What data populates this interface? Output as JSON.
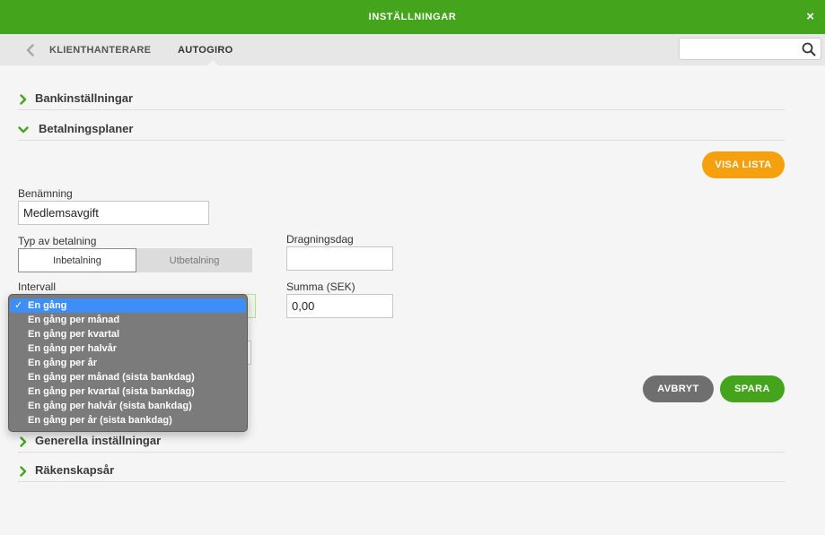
{
  "window": {
    "title": "INSTÄLLNINGAR",
    "close_glyph": "×"
  },
  "nav": {
    "back_icon": "chevron-left-icon",
    "items": [
      {
        "label": "KLIENTHANTERARE",
        "active": false
      },
      {
        "label": "AUTOGIRO",
        "active": true
      }
    ],
    "search": {
      "value": "",
      "placeholder": ""
    }
  },
  "sections": {
    "bank": {
      "label": "Bankinställningar",
      "icon": "chevron-right-icon"
    },
    "plans": {
      "label": "Betalningsplaner",
      "icon": "chevron-down-icon"
    },
    "general": {
      "label": "Generella inställningar",
      "icon": "chevron-right-icon"
    },
    "fiscal": {
      "label": "Räkenskapsår",
      "icon": "chevron-right-icon"
    }
  },
  "form": {
    "show_list_label": "VISA LISTA",
    "name_label": "Benämning",
    "name_value": "Medlemsavgift",
    "payment_type_label": "Typ av betalning",
    "payment_type_options": [
      "Inbetalning",
      "Utbetalning"
    ],
    "payment_type_selected": "Inbetalning",
    "draw_day_label": "Dragningsdag",
    "draw_day_value": "",
    "interval_label": "Intervall",
    "amount_label": "Summa (SEK)",
    "amount_value": "0,00",
    "cancel_label": "AVBRYT",
    "save_label": "SPARA"
  },
  "interval_dropdown": {
    "selected": "En gång",
    "options": [
      "En gång",
      "En gång per månad",
      "En gång per kvartal",
      "En gång per halvår",
      "En gång per år",
      "En gång per månad (sista bankdag)",
      "En gång per kvartal (sista bankdag)",
      "En gång per halvår (sista bankdag)",
      "En gång per år (sista bankdag)"
    ],
    "check_glyph": "✓"
  },
  "colors": {
    "brand_green": "#44a51c",
    "accent_orange": "#f5a00c",
    "cancel_gray": "#6f6f6f",
    "dropdown_bg": "#7b7b7b",
    "dropdown_selected": "#3d8ff7"
  }
}
